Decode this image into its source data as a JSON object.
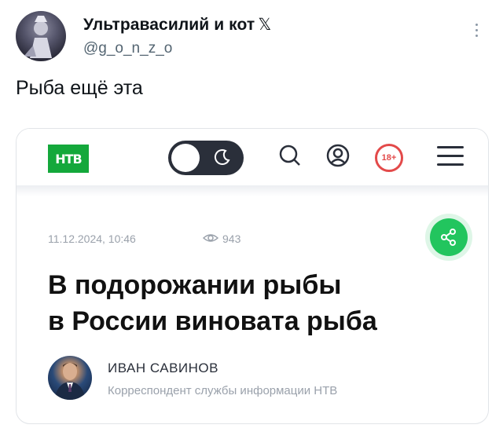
{
  "tweet": {
    "author_name": "Ультравасилий и кот",
    "verified_glyph": "𝕏",
    "handle": "@g_o_n_z_o",
    "text": "Рыба ещё эта",
    "more_icon": "more-vertical-icon"
  },
  "card": {
    "logo_text": "НТВ",
    "toggle_icon": "moon-icon",
    "age_badge": "18+",
    "date": "11.12.2024, 10:46",
    "views": "943",
    "share_icon": "share-icon",
    "headline_line1": "В подорожании рыбы",
    "headline_line2": "в России виновата рыба",
    "author_name": "ИВАН САВИНОВ",
    "author_role": "Корреспондент службы информации НТВ"
  },
  "colors": {
    "brand_green": "#14a83b",
    "share_green": "#22c55e",
    "age_red": "#e34a4a"
  }
}
